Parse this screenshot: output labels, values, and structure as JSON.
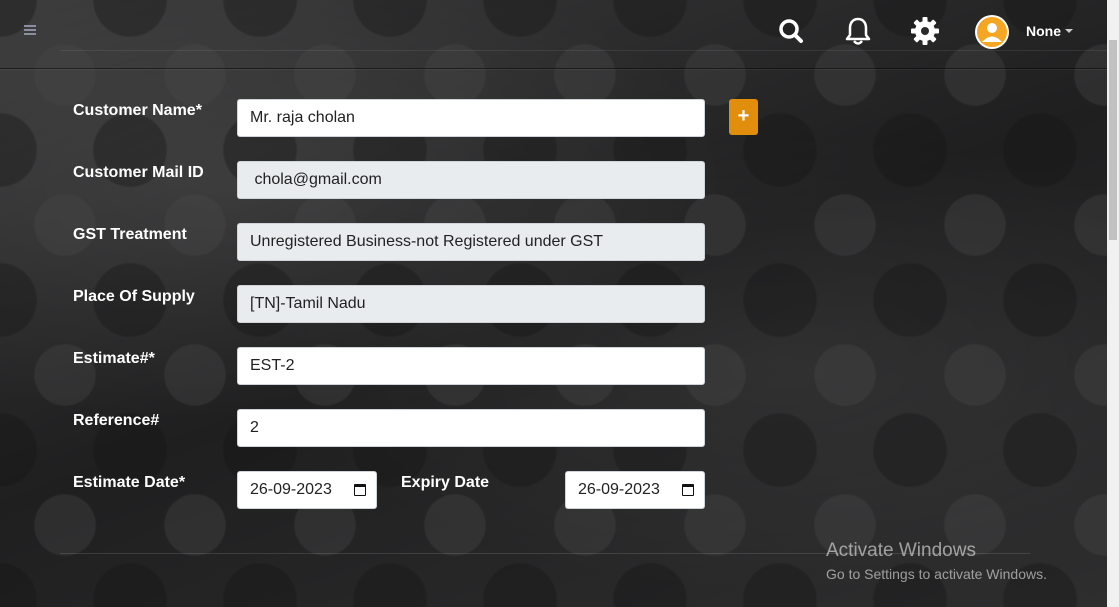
{
  "header": {
    "user_name": "None",
    "icons": [
      "search-icon",
      "bell-icon",
      "gear-icon",
      "avatar-icon"
    ]
  },
  "form": {
    "customer_name": {
      "label": "Customer Name*",
      "value": "Mr. raja cholan"
    },
    "customer_mail": {
      "label": "Customer Mail ID",
      "value": " chola@gmail.com"
    },
    "gst_treatment": {
      "label": "GST Treatment",
      "value": "Unregistered Business-not Registered under GST"
    },
    "place_of_supply": {
      "label": "Place Of Supply",
      "value": "[TN]-Tamil Nadu"
    },
    "estimate_no": {
      "label": "Estimate#*",
      "value": "EST-2"
    },
    "reference_no": {
      "label": "Reference#",
      "value": "2"
    },
    "estimate_date": {
      "label": "Estimate Date*",
      "value": "26-09-2023"
    },
    "expiry_date": {
      "label": "Expiry Date",
      "value": "26-09-2023"
    },
    "add_customer_label": "+"
  },
  "watermark": {
    "line1": "Activate Windows",
    "line2": "Go to Settings to activate Windows."
  },
  "colors": {
    "accent": "#e08e0b",
    "readonly_bg": "#e9ecef"
  }
}
